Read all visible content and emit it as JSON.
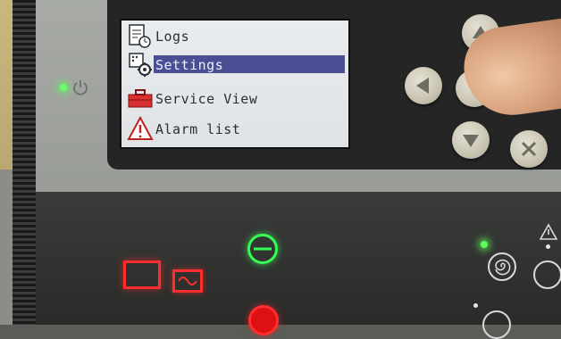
{
  "screen": {
    "menu": [
      {
        "label": "Logs",
        "icon": "logs-icon",
        "selected": false
      },
      {
        "label": "Settings",
        "icon": "settings-icon",
        "selected": true
      },
      {
        "label": "Service View",
        "icon": "toolbox-icon",
        "selected": false
      },
      {
        "label": "Alarm list",
        "icon": "warning-icon",
        "selected": false
      }
    ]
  },
  "keypad": [
    "up-arrow-icon",
    "left-arrow-icon",
    "down-arrow-icon",
    "close-icon"
  ],
  "colors": {
    "selection": "#4a4f93",
    "led_green": "#35ff55",
    "led_red": "#ff2d2d",
    "screen_bg": "#e6e9ec"
  }
}
